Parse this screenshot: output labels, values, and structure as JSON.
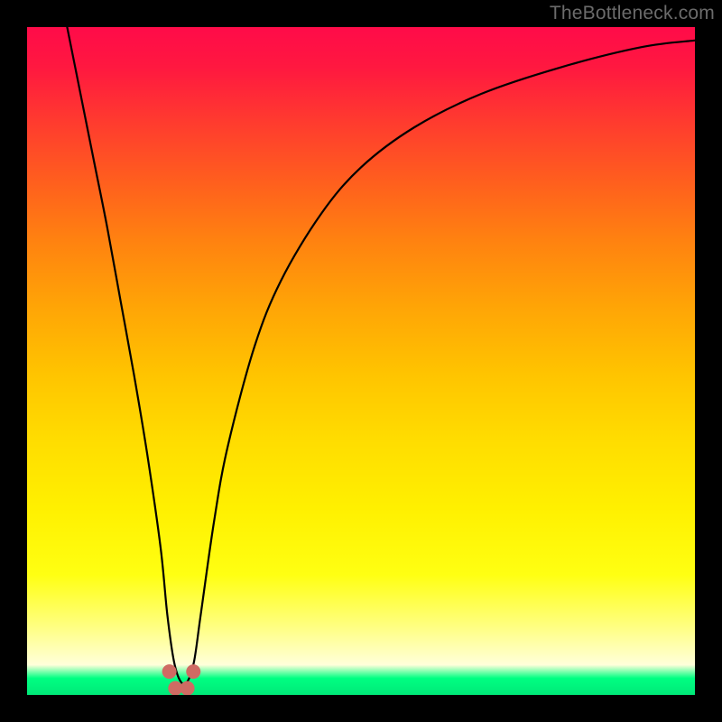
{
  "attribution": "TheBottleneck.com",
  "chart_data": {
    "type": "line",
    "title": "",
    "xlabel": "",
    "ylabel": "",
    "xlim": [
      0,
      100
    ],
    "ylim": [
      0,
      100
    ],
    "grid": false,
    "legend": false,
    "series": [
      {
        "name": "bottleneck-curve",
        "color": "#000000",
        "x": [
          6,
          8,
          10,
          12,
          14,
          16,
          18,
          20,
          21,
          22,
          23,
          24,
          25,
          26,
          28,
          30,
          34,
          38,
          44,
          50,
          58,
          68,
          80,
          92,
          100
        ],
        "y": [
          100,
          90,
          80,
          70,
          59,
          48,
          36,
          22,
          12,
          5,
          2,
          2,
          5,
          12,
          26,
          37,
          52,
          62,
          72,
          79,
          85,
          90,
          94,
          97,
          98
        ]
      }
    ],
    "markers": [
      {
        "name": "valley-left-top",
        "x": 21.3,
        "y": 3.5,
        "color": "#cf6b63"
      },
      {
        "name": "valley-left-bot",
        "x": 22.2,
        "y": 1.0,
        "color": "#cf6b63"
      },
      {
        "name": "valley-right-bot",
        "x": 24.0,
        "y": 1.0,
        "color": "#cf6b63"
      },
      {
        "name": "valley-right-top",
        "x": 24.9,
        "y": 3.5,
        "color": "#cf6b63"
      }
    ]
  }
}
